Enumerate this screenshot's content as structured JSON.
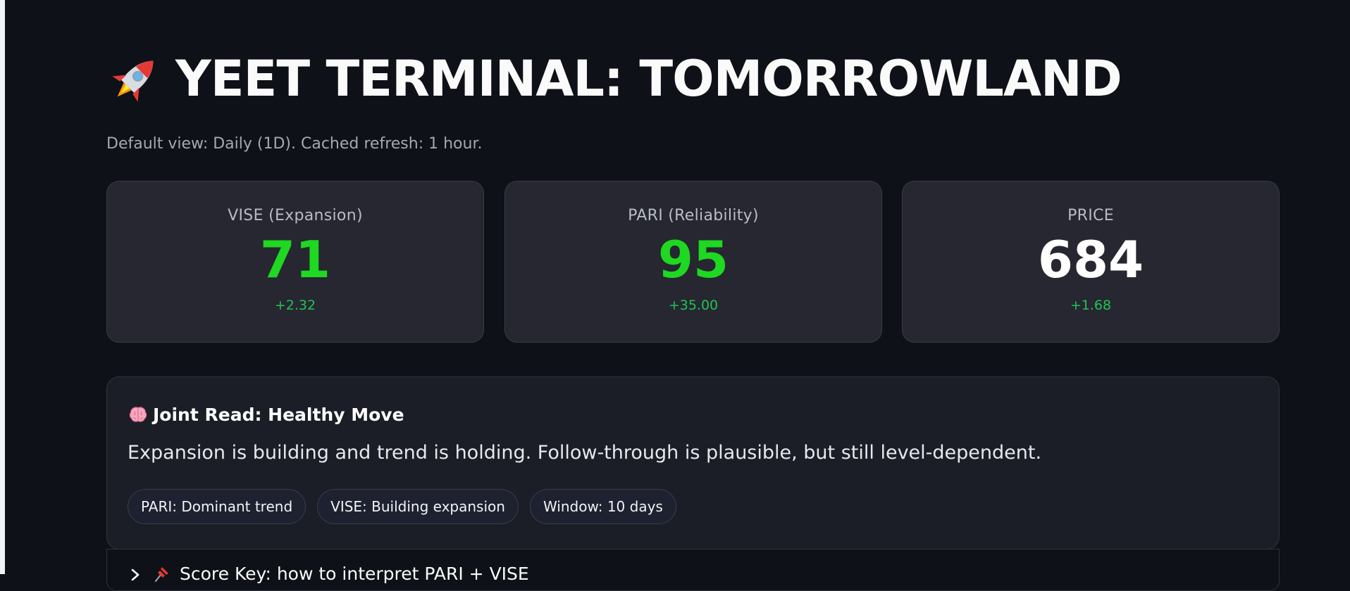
{
  "header": {
    "title": "YEET TERMINAL: TOMORROWLAND",
    "icon": "rocket-icon",
    "subtitle": "Default view: Daily (1D). Cached refresh: 1 hour."
  },
  "metrics": [
    {
      "label": "VISE (Expansion)",
      "value": "71",
      "delta": "+2.32",
      "value_color": "#1ed822"
    },
    {
      "label": "PARI (Reliability)",
      "value": "95",
      "delta": "+35.00",
      "value_color": "#1ed822"
    },
    {
      "label": "PRICE",
      "value": "684",
      "delta": "+1.68",
      "value_color": "#ffffff"
    }
  ],
  "joint_read": {
    "icon": "brain-icon",
    "title": "Joint Read: Healthy Move",
    "description": "Expansion is building and trend is holding. Follow-through is plausible, but still level-dependent.",
    "pills": [
      "PARI: Dominant trend",
      "VISE: Building expansion",
      "Window: 10 days"
    ]
  },
  "score_key": {
    "icon": "pushpin-icon",
    "label": "Score Key: how to interpret PARI + VISE"
  },
  "colors": {
    "background": "#0e1117",
    "card": "#262730",
    "positive": "#1ed822",
    "delta": "#21c354"
  }
}
